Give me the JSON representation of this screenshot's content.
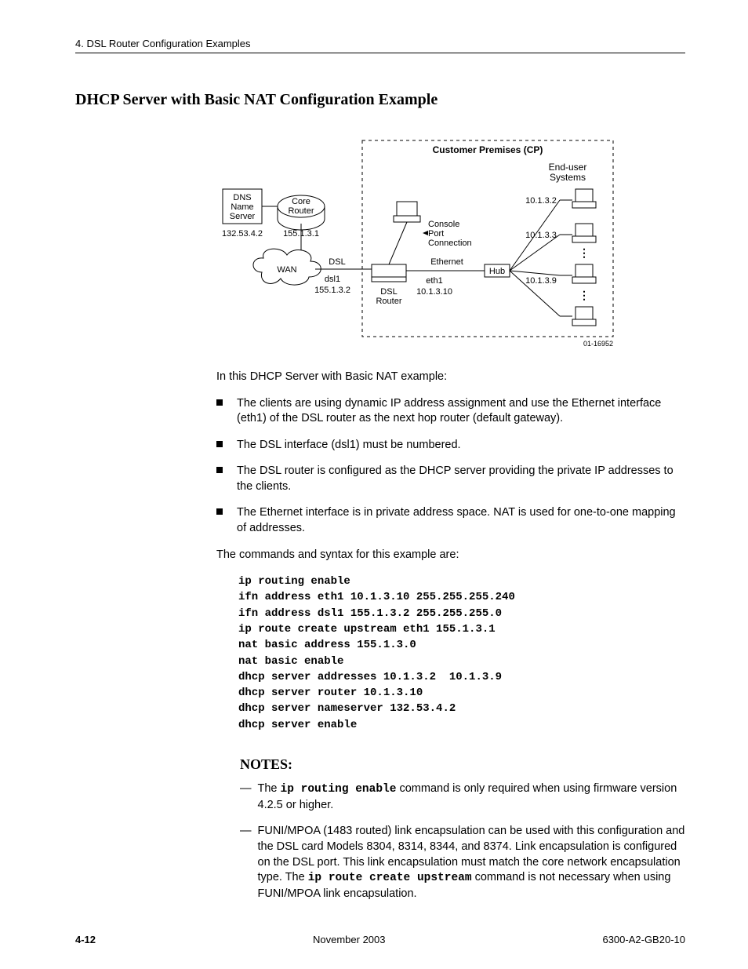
{
  "header": {
    "chapter": "4. DSL Router Configuration Examples"
  },
  "title": "DHCP Server with Basic NAT Configuration Example",
  "diagram": {
    "cp_box": "Customer Premises (CP)",
    "end_user": "End-user\nSystems",
    "dns1": "DNS",
    "dns2": "Name",
    "dns3": "Server",
    "dns_ip": "132.53.4.2",
    "core1": "Core",
    "core2": "Router",
    "core_ip": "155.1.3.1",
    "wan": "WAN",
    "dsl_lbl": "DSL",
    "dsl_if": "dsl1",
    "dsl_ip": "155.1.3.2",
    "dsl_router1": "DSL",
    "dsl_router2": "Router",
    "console1": "Console",
    "console2": "Port",
    "console3": "Connection",
    "eth_lbl": "Ethernet",
    "eth_if": "eth1",
    "eth_ip": "10.1.3.10",
    "hub": "Hub",
    "pc1": "10.1.3.2",
    "pc2": "10.1.3.3",
    "pc3": "10.1.3.9",
    "fig_id": "01-16952"
  },
  "intro": "In this DHCP Server with Basic NAT example:",
  "bullets": [
    "The clients are using dynamic IP address assignment and use the Ethernet interface (eth1) of the DSL router as the next hop router (default gateway).",
    "The DSL interface (dsl1) must be numbered.",
    "The DSL router is configured as the DHCP server providing the private IP addresses to the clients.",
    "The Ethernet interface is in private address space. NAT is used for one-to-one mapping of addresses."
  ],
  "cmds_intro": "The commands and syntax for this example are:",
  "cmds": "ip routing enable\nifn address eth1 10.1.3.10 255.255.255.240\nifn address dsl1 155.1.3.2 255.255.255.0\nip route create upstream eth1 155.1.3.1\nnat basic address 155.1.3.0\nnat basic enable\ndhcp server addresses 10.1.3.2  10.1.3.9\ndhcp server router 10.1.3.10\ndhcp server nameserver 132.53.4.2\ndhcp server enable",
  "notes_heading": "NOTES:",
  "notes": [
    {
      "pre": "The ",
      "code": "ip routing enable",
      "post": " command is only required when using firmware version 4.2.5 or higher."
    },
    {
      "pre": "FUNI/MPOA (1483 routed) link encapsulation can be used with this configuration and the DSL card Models 8304, 8314, 8344, and 8374. Link encapsulation is configured on the DSL port. This link encapsulation must match the core network encapsulation type. The ",
      "code": "ip route create upstream",
      "post": " command is not necessary when using FUNI/MPOA link encapsulation."
    }
  ],
  "footer": {
    "page": "4-12",
    "date": "November 2003",
    "doc": "6300-A2-GB20-10"
  }
}
